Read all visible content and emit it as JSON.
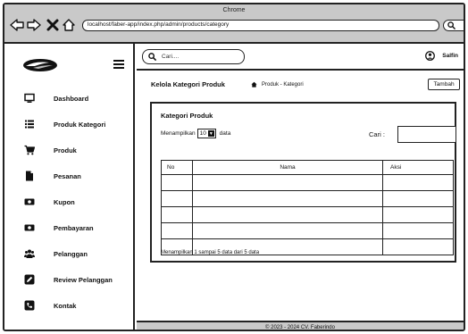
{
  "browser": {
    "title": "Chrome",
    "url": "localhost/faber-app/index.php/admin/products/category"
  },
  "sidebar": {
    "items": [
      {
        "label": "Dashboard",
        "icon": "monitor-icon"
      },
      {
        "label": "Produk Kategori",
        "icon": "list-icon"
      },
      {
        "label": "Produk",
        "icon": "cart-icon"
      },
      {
        "label": "Pesanan",
        "icon": "file-icon"
      },
      {
        "label": "Kupon",
        "icon": "ticket-icon"
      },
      {
        "label": "Pembayaran",
        "icon": "money-icon"
      },
      {
        "label": "Pelanggan",
        "icon": "users-icon"
      },
      {
        "label": "Review Pelanggan",
        "icon": "edit-icon"
      },
      {
        "label": "Kontak",
        "icon": "phone-icon"
      }
    ]
  },
  "header": {
    "search_placeholder": "Cari....",
    "username": "Salfin"
  },
  "page": {
    "title": "Kelola Kategori Produk",
    "breadcrumb": "Produk - Kategori",
    "add_button": "Tambah"
  },
  "card": {
    "title": "Kategori Produk",
    "show_prefix": "Menampilkan",
    "show_value": "10",
    "show_suffix": "data",
    "search_label": "Cari :",
    "table": {
      "headers": [
        "No",
        "Nama",
        "Aksi"
      ],
      "row_count": 5
    },
    "info": "Menampilkan 1 sampai 5 data dari 5 data"
  },
  "footer": {
    "text": "© 2023 - 2024 CV. Faberindo"
  }
}
